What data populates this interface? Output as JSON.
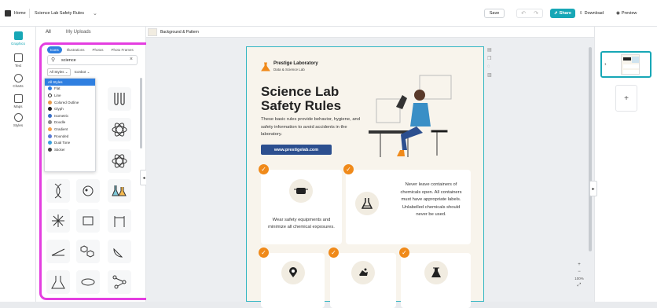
{
  "topbar": {
    "home": "Home",
    "doc_title": "Science Lab Safety Rules",
    "save": "Save",
    "share": "Share",
    "download": "Download",
    "preview": "Preview"
  },
  "leftnav": {
    "items": [
      "Graphics",
      "Text",
      "Charts",
      "Maps",
      "Styles"
    ]
  },
  "panel": {
    "tabs": [
      "All",
      "My Uploads"
    ],
    "chips": [
      "Icons",
      "Illustrations",
      "Photos",
      "Photo Frames"
    ],
    "search_value": "science",
    "filter_style": "All Styles",
    "filter_type": "Iconbot",
    "dropdown": [
      "All Styles",
      "Flat",
      "Line",
      "Colored Outline",
      "Glyph",
      "Isometric",
      "Doodle",
      "Gradient",
      "Rounded",
      "Dual Tone",
      "Sticker"
    ]
  },
  "canvas": {
    "toolbar_label": "Background & Pattern",
    "brand": "Prestige Laboratory",
    "brand_sub": "Data & Science Lab",
    "title_line1": "Science Lab",
    "title_line2": "Safety Rules",
    "intro": "These basic rules provide behavior, hygiene, and safety information to avoid accidents in the laboratory.",
    "url": "www.prestigelab.com",
    "card1": "Wear safety equipments and minimize all chemical exposures.",
    "card2": "Never leave containers of chemicals open. All containers must have appropriate labels. Unlabelled chemicals should never be used."
  },
  "zoom": {
    "plus": "+",
    "minus": "−",
    "value": "100%"
  },
  "pages": {
    "page_num": "1",
    "add": "+"
  },
  "colors": {
    "accent_blue": "#2f7fe0",
    "share_teal": "#17a7b6",
    "highlight_pink": "#e43ee0",
    "orange": "#f08a1a",
    "navy": "#2c4f8f"
  }
}
